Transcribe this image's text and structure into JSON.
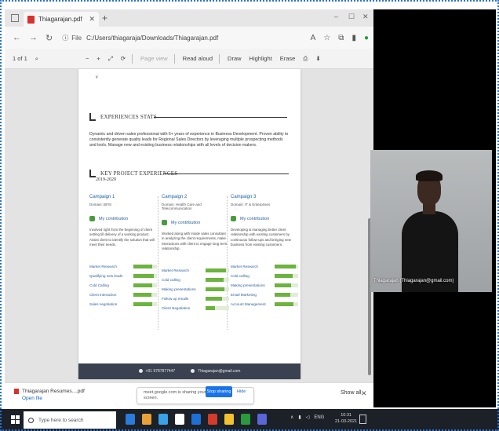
{
  "browser": {
    "tab_title": "Thiagarajan.pdf",
    "new_tab": "+",
    "url_label": "File",
    "url": "C:/Users/thiagaraja/Downloads/Thiagarajan.pdf",
    "window_min": "–",
    "window_max": "☐",
    "window_close": "✕"
  },
  "pdf_toolbar": {
    "page_nav": "1 of 1",
    "zoom_out": "−",
    "zoom_in": "+",
    "page_view": "Page view",
    "read_aloud": "Read aloud",
    "draw": "Draw",
    "highlight": "Highlight",
    "erase": "Erase"
  },
  "document": {
    "section_experience": "EXPERIENCES STATS",
    "summary": "Dynamic and driven sales professional with 6+ years of experience in Business Development. Proven ability to consistently generate quality leads for Regional Sales Directors by leveraging multiple prospecting methods and tools. Manage new and existing business relationships with all levels of decision makers.",
    "section_projects": "KEY PROJECT EXPERIENCES",
    "years": "2019-2020",
    "contribution_label": "My contribution",
    "campaigns": [
      {
        "title": "Campaign 1",
        "sub": "Domain: BFSI",
        "desc": "Involved right from the beginning of client setting till delivery of a working product. Assist client to identify the solution that will meet their needs.",
        "skills": [
          {
            "name": "Market Research",
            "level": 0.8
          },
          {
            "name": "Qualifying new leads",
            "level": 0.85
          },
          {
            "name": "Cold Calling",
            "level": 0.8
          },
          {
            "name": "Client Interaction",
            "level": 0.75
          },
          {
            "name": "Sales negotiation",
            "level": 0.8
          }
        ]
      },
      {
        "title": "Campaign 2",
        "sub": "Domain: Health Care and Telecommunication",
        "desc": "Worked along with Inside sales consultant in analyzing the client requirements, make interactions with client to engage long term relationship.",
        "skills": [
          {
            "name": "Market Research",
            "level": 0.85
          },
          {
            "name": "Cold calling",
            "level": 0.75
          },
          {
            "name": "Making presentations",
            "level": 0.8
          },
          {
            "name": "Follow up emails",
            "level": 0.7
          },
          {
            "name": "Client Negotiation",
            "level": 0.4
          }
        ]
      },
      {
        "title": "Campaign 3",
        "sub": "Domain: IT & Enterprises",
        "desc": "Developing & managing better client relationship with existing customers by continuous follow-ups and bringing new business from existing customers.",
        "skills": [
          {
            "name": "Market Research",
            "level": 0.9
          },
          {
            "name": "Cold calling",
            "level": 0.75
          },
          {
            "name": "Making presentations",
            "level": 0.7
          },
          {
            "name": "Email Marketing",
            "level": 0.65
          },
          {
            "name": "Account Management",
            "level": 0.8
          }
        ]
      }
    ],
    "footer_phone": "+91 9787877447",
    "footer_email": "Thiagarajan@gmail.com"
  },
  "download_bar": {
    "file_name": "Thiagarajan Resumes....pdf",
    "open_file": "Open file",
    "share_message": "meet.google.com is sharing your screen.",
    "stop_sharing": "Stop sharing",
    "hide": "Hide",
    "show_all": "Show all",
    "close": "✕"
  },
  "video": {
    "participant": "Thiagarajan (Thiagarajan@gmail.com)"
  },
  "taskbar": {
    "search_placeholder": "Type here to search",
    "time": "10:31",
    "date": "21-03-2021",
    "lang": "ENG",
    "app_colors": [
      "#2b7bd8",
      "#e8a23a",
      "#3aa3e8",
      "#ffffff",
      "#1e6fd6",
      "#d33b2c",
      "#f2c22f",
      "#2b9a3e",
      "#5b66d9"
    ]
  }
}
